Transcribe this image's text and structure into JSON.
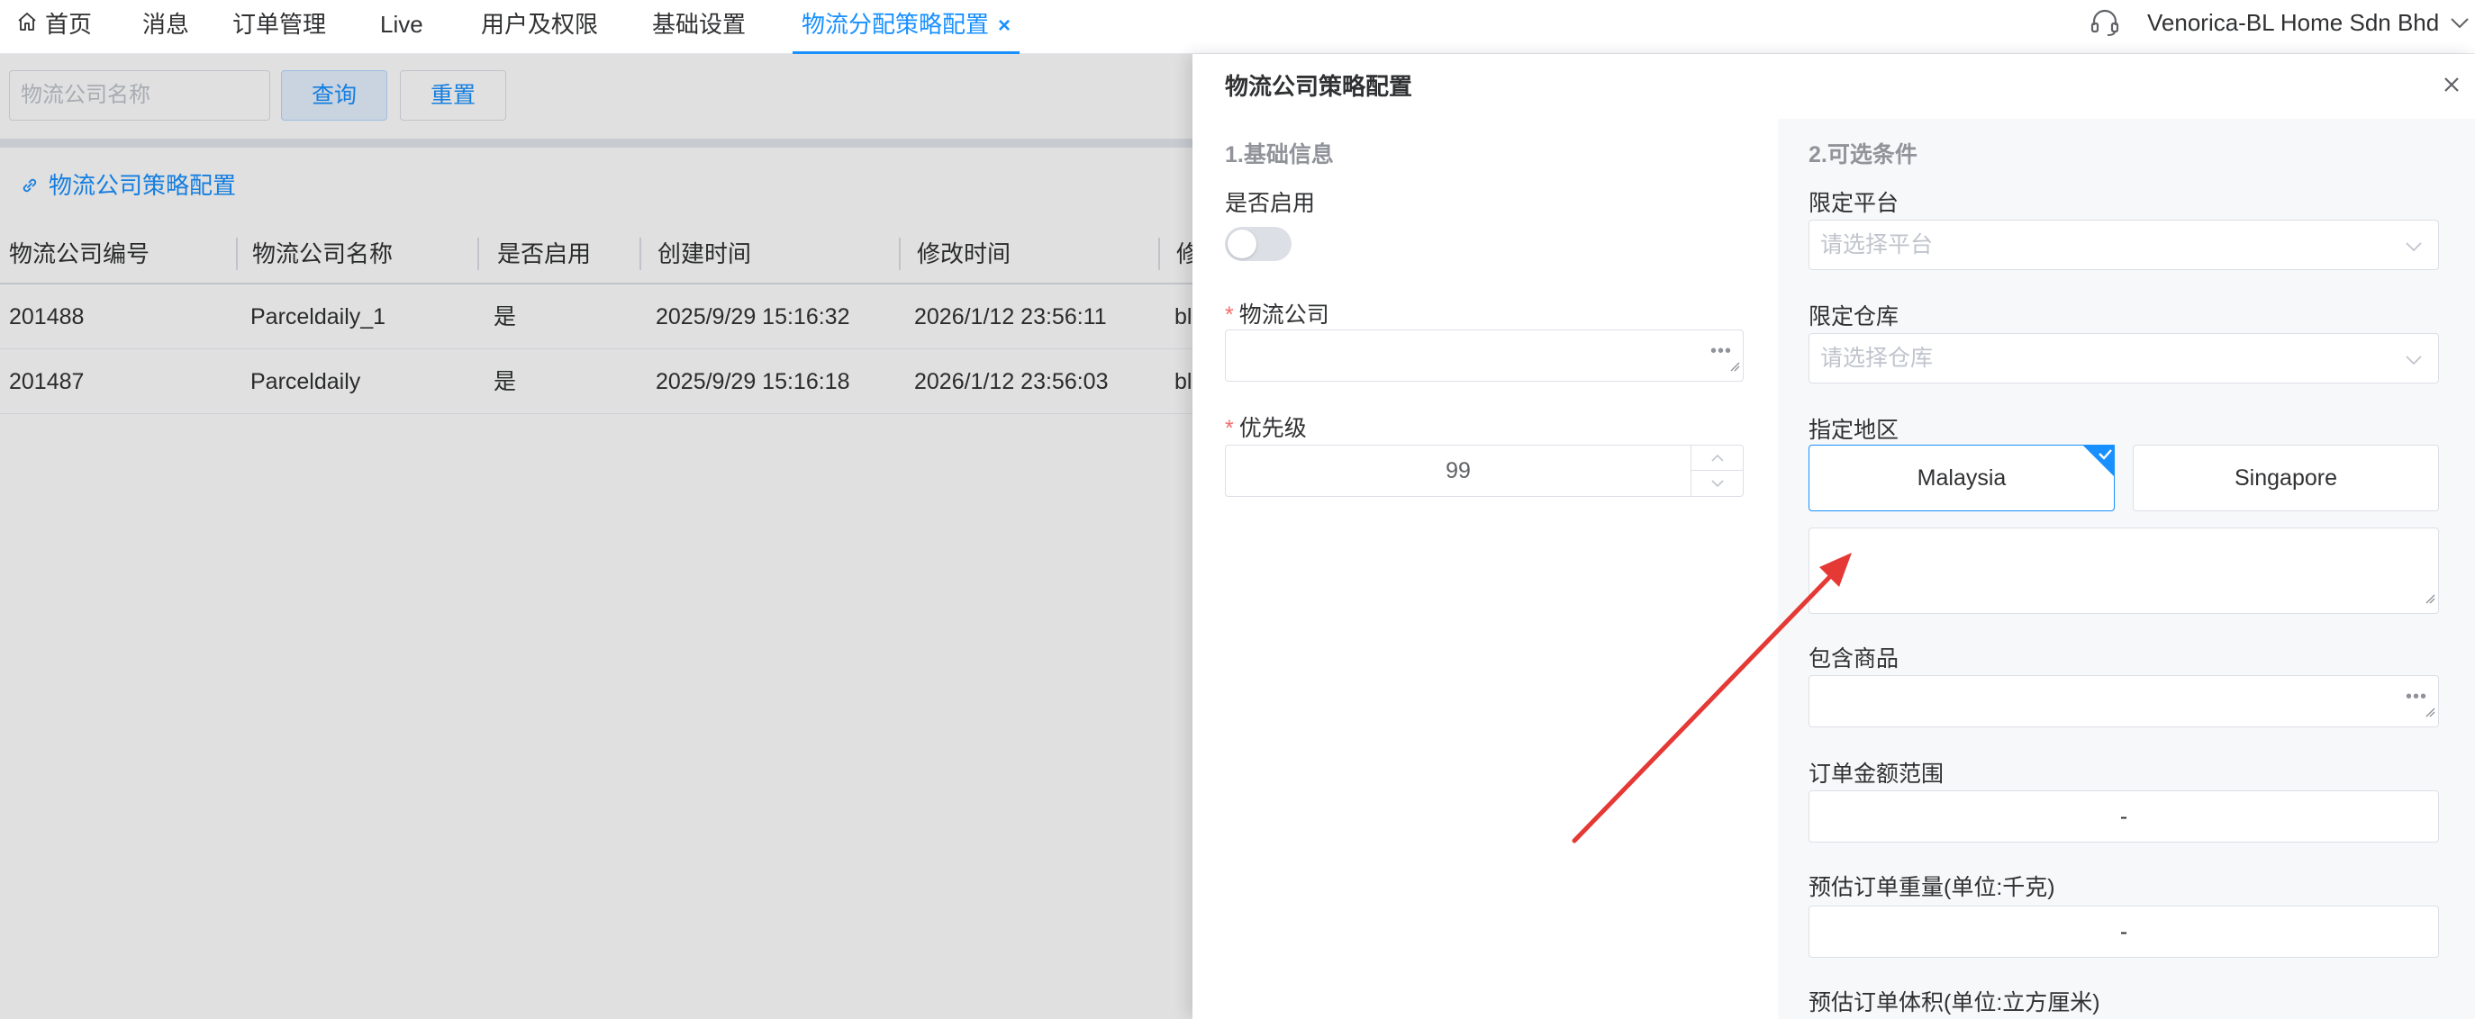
{
  "nav": {
    "home": "首页",
    "messages": "消息",
    "orders": "订单管理",
    "live": "Live",
    "users": "用户及权限",
    "settings": "基础设置",
    "active_tab": "物流分配策略配置",
    "tab_close": "×",
    "company": "Venorica-BL Home Sdn Bhd"
  },
  "search": {
    "placeholder": "物流公司名称",
    "query_label": "查询",
    "reset_label": "重置"
  },
  "section": {
    "title": "物流公司策略配置"
  },
  "table": {
    "columns": [
      "物流公司编号",
      "物流公司名称",
      "是否启用",
      "创建时间",
      "修改时间",
      "修"
    ],
    "rows": [
      [
        "201488",
        "Parceldaily_1",
        "是",
        "2025/9/29 15:16:32",
        "2026/1/12 23:56:11",
        "bl"
      ],
      [
        "201487",
        "Parceldaily",
        "是",
        "2025/9/29 15:16:18",
        "2026/1/12 23:56:03",
        "bl"
      ]
    ]
  },
  "drawer": {
    "title": "物流公司策略配置",
    "basic": {
      "section": "1.基础信息",
      "enable_label": "是否启用",
      "enabled": false,
      "company_label": "物流公司",
      "company_value": "",
      "priority_label": "优先级",
      "priority_value": "99"
    },
    "optional": {
      "section": "2.可选条件",
      "platform_label": "限定平台",
      "platform_placeholder": "请选择平台",
      "warehouse_label": "限定仓库",
      "warehouse_placeholder": "请选择仓库",
      "region_label": "指定地区",
      "regions": [
        {
          "name": "Malaysia",
          "selected": true
        },
        {
          "name": "Singapore",
          "selected": false
        }
      ],
      "region_note": "",
      "goods_label": "包含商品",
      "amount_label": "订单金额范围",
      "amount_sep": "-",
      "weight_label": "预估订单重量(单位:千克)",
      "weight_sep": "-",
      "volume_label": "预估订单体积(单位:立方厘米)"
    }
  },
  "colors": {
    "primary": "#1890ff",
    "required": "#f56c6c",
    "annotation": "#e53935"
  },
  "icons": [
    "home-icon",
    "headset-icon",
    "chevron-down-icon",
    "link-icon",
    "close-icon",
    "check-icon",
    "resize-handle-icon",
    "arrow-annotation"
  ]
}
